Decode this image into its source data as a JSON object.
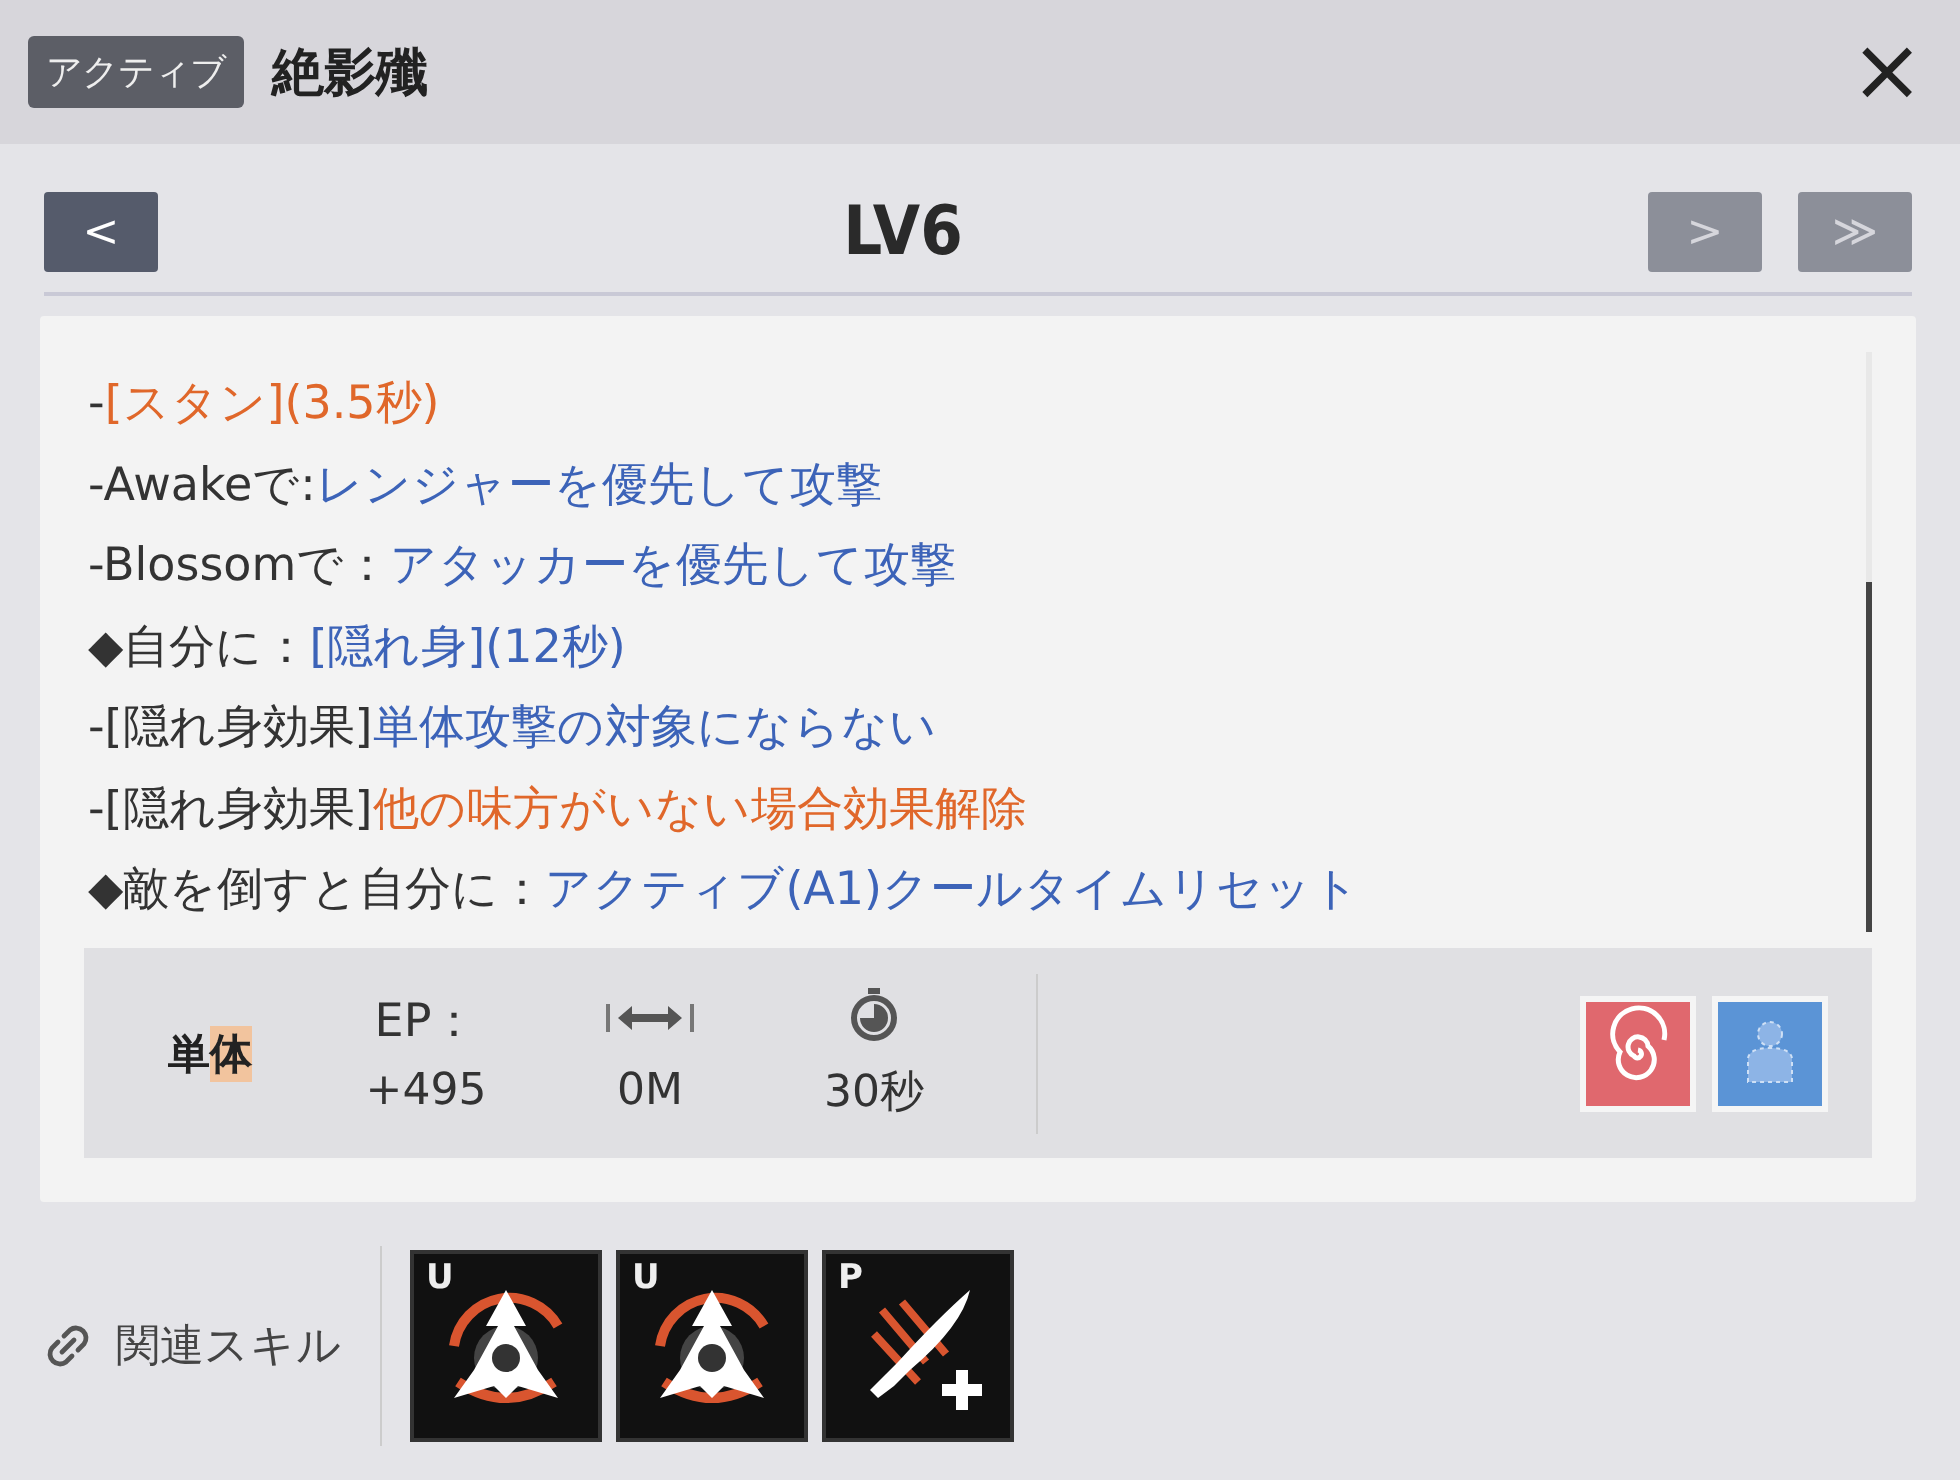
{
  "header": {
    "tag": "アクティブ",
    "title": "絶影殲",
    "close": "×"
  },
  "level_nav": {
    "label": "LV6",
    "buttons": [
      {
        "kind": "prev",
        "glyph": "<",
        "disabled": false
      },
      {
        "kind": "next",
        "glyph": ">",
        "disabled": true
      },
      {
        "kind": "last",
        "glyph": "≫",
        "disabled": true
      }
    ]
  },
  "description": [
    [
      {
        "text": "-",
        "color": "#333333"
      },
      {
        "text": "[スタン](3.5秒)",
        "color": "#e0672a"
      }
    ],
    [
      {
        "text": "-Awakeで:",
        "color": "#333333"
      },
      {
        "text": "レンジャーを優先して攻撃",
        "color": "#3c63b8"
      }
    ],
    [
      {
        "text": "-Blossomで：",
        "color": "#333333"
      },
      {
        "text": "アタッカーを優先して攻撃",
        "color": "#3c63b8"
      }
    ],
    [
      {
        "text": "◆自分に：",
        "color": "#333333"
      },
      {
        "text": "[隠れ身](12秒)",
        "color": "#3c63b8"
      }
    ],
    [
      {
        "text": "-[隠れ身効果]",
        "color": "#333333"
      },
      {
        "text": "単体攻撃の対象にならない",
        "color": "#3c63b8"
      }
    ],
    [
      {
        "text": "-[隠れ身効果]",
        "color": "#333333"
      },
      {
        "text": "他の味方がいない場合効果解除",
        "color": "#e0672a"
      }
    ],
    [
      {
        "text": "◆敵を倒すと自分に：",
        "color": "#333333"
      },
      {
        "text": "アクティブ(A1)クールタイムリセット",
        "color": "#3c63b8"
      }
    ]
  ],
  "stats": {
    "target": "単体",
    "items": [
      {
        "kind": "label",
        "label": "EP：",
        "value": "+495"
      },
      {
        "kind": "range",
        "value": "0M"
      },
      {
        "kind": "cooldown",
        "value": "30秒"
      }
    ],
    "badges": [
      {
        "kind": "spiral",
        "color": "#e0686e"
      },
      {
        "kind": "figure",
        "color": "#5b94d6"
      }
    ]
  },
  "related": {
    "label": "関連スキル",
    "skills": [
      {
        "letter": "U",
        "kind": "triad"
      },
      {
        "letter": "U",
        "kind": "triad"
      },
      {
        "letter": "P",
        "kind": "blade"
      }
    ]
  }
}
